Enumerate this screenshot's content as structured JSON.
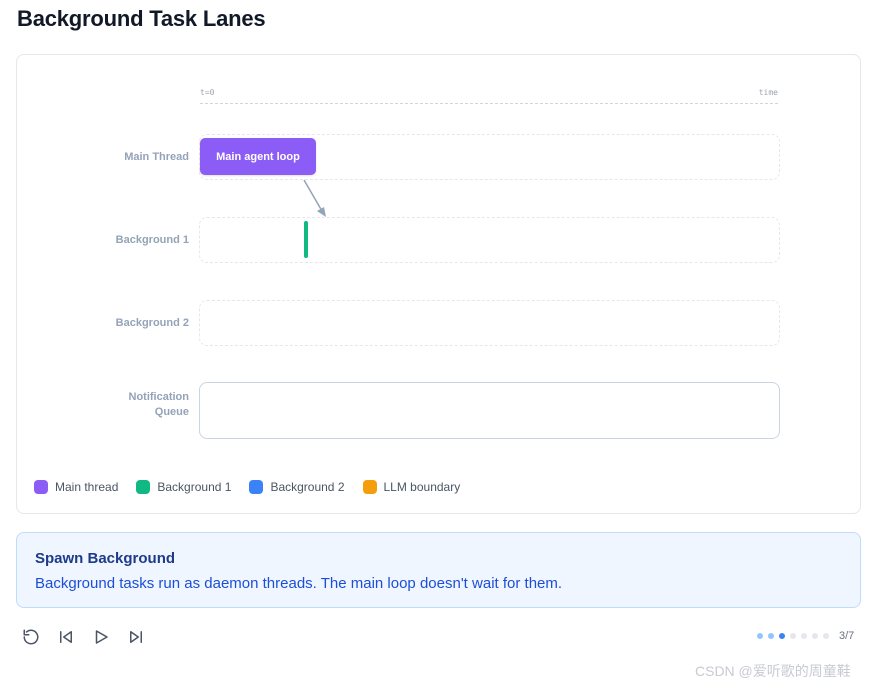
{
  "page": {
    "title": "Background Task Lanes"
  },
  "timeline": {
    "start_label": "t=0",
    "end_label": "time"
  },
  "lanes": [
    {
      "label": "Main Thread"
    },
    {
      "label": "Background 1"
    },
    {
      "label": "Background 2"
    },
    {
      "label_line1": "Notification",
      "label_line2": "Queue"
    }
  ],
  "tasks": {
    "main_block_label": "Main agent loop"
  },
  "legend": [
    {
      "label": "Main thread",
      "color": "#8b5cf6"
    },
    {
      "label": "Background 1",
      "color": "#10b981"
    },
    {
      "label": "Background 2",
      "color": "#3b82f6"
    },
    {
      "label": "LLM boundary",
      "color": "#f59e0b"
    }
  ],
  "info": {
    "title": "Spawn Background",
    "text": "Background tasks run as daemon threads. The main loop doesn't wait for them."
  },
  "controls": {
    "reset_icon": "restart-icon",
    "prev_icon": "skip-back-icon",
    "play_icon": "play-icon",
    "next_icon": "skip-forward-icon"
  },
  "steps": {
    "current": 3,
    "total": 7,
    "counter_text": "3/7"
  },
  "watermark": "CSDN @爱听歌的周童鞋"
}
